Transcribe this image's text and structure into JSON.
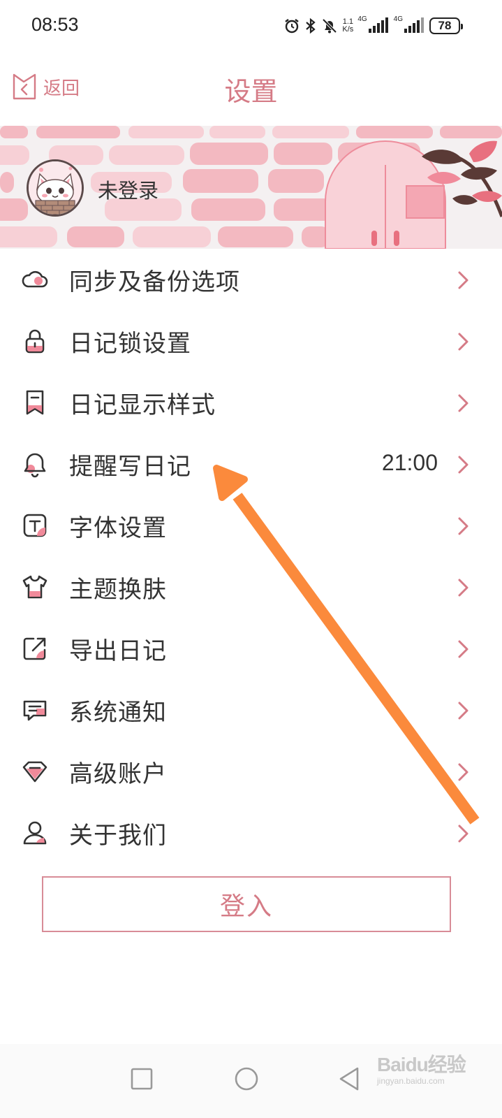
{
  "status_bar": {
    "time": "08:53",
    "net_speed_value": "1.1",
    "net_speed_unit": "K/s",
    "signal1_label": "4G",
    "signal2_label": "4G",
    "battery": "78"
  },
  "header": {
    "back_label": "返回",
    "title": "设置"
  },
  "profile": {
    "status": "未登录"
  },
  "menu": {
    "items": [
      {
        "label": "同步及备份选项",
        "icon": "cloud-icon",
        "value": ""
      },
      {
        "label": "日记锁设置",
        "icon": "lock-icon",
        "value": ""
      },
      {
        "label": "日记显示样式",
        "icon": "bookmark-icon",
        "value": ""
      },
      {
        "label": "提醒写日记",
        "icon": "bell-icon",
        "value": "21:00"
      },
      {
        "label": "字体设置",
        "icon": "font-icon",
        "value": ""
      },
      {
        "label": "主题换肤",
        "icon": "shirt-icon",
        "value": ""
      },
      {
        "label": "导出日记",
        "icon": "export-icon",
        "value": ""
      },
      {
        "label": "系统通知",
        "icon": "message-icon",
        "value": ""
      },
      {
        "label": "高级账户",
        "icon": "diamond-icon",
        "value": ""
      },
      {
        "label": "关于我们",
        "icon": "user-icon",
        "value": ""
      }
    ]
  },
  "login_button": "登入",
  "watermark": {
    "main": "Baidu经验",
    "sub": "jingyan.baidu.com"
  },
  "colors": {
    "accent": "#d57b86",
    "icon_fill": "#f08a9a",
    "annotation_arrow": "#fb8a3c"
  }
}
